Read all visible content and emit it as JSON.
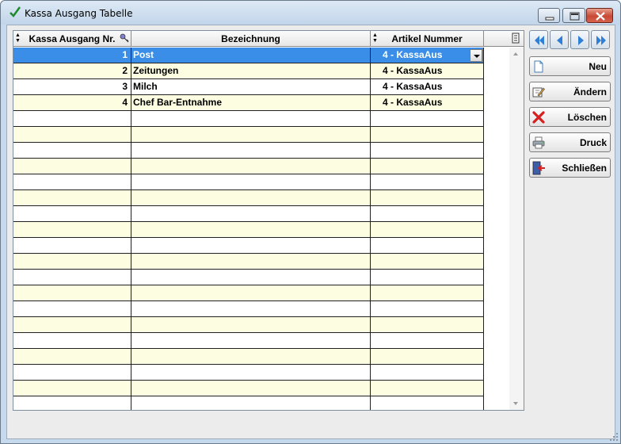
{
  "window": {
    "title": "Kassa Ausgang Tabelle",
    "icon": "checkmark-icon"
  },
  "grid": {
    "columns": [
      {
        "label": "Kassa Ausgang Nr."
      },
      {
        "label": "Bezeichnung"
      },
      {
        "label": "Artikel Nummer"
      }
    ],
    "rows": [
      {
        "nr": "1",
        "bezeichnung": "Post",
        "artikel": "4 - KassaAus",
        "selected": true
      },
      {
        "nr": "2",
        "bezeichnung": "Zeitungen",
        "artikel": "4 - KassaAus"
      },
      {
        "nr": "3",
        "bezeichnung": "Milch",
        "artikel": "4 - KassaAus"
      },
      {
        "nr": "4",
        "bezeichnung": "Chef Bar-Entnahme",
        "artikel": "4 - KassaAus"
      }
    ]
  },
  "actions": {
    "neu": "Neu",
    "aendern": "Ändern",
    "loeschen": "Löschen",
    "druck": "Druck",
    "schliessen": "Schließen"
  },
  "colors": {
    "selected_row": "#3b8ee8",
    "row_alt": "#fdfde1",
    "nav_arrow": "#2f7fd6",
    "delete_x": "#d42020"
  }
}
